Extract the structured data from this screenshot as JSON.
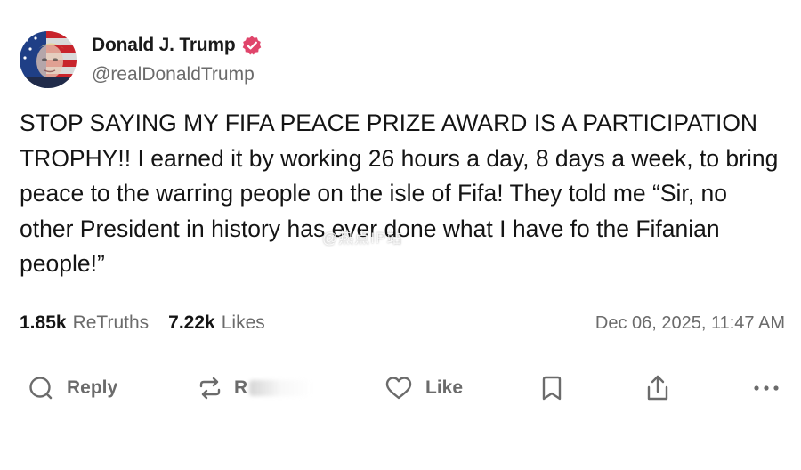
{
  "author": {
    "display_name": "Donald J. Trump",
    "handle": "@realDonaldTrump",
    "verified": true,
    "verified_color": "#e0456b",
    "avatar_icon": "avatar-portrait-flag"
  },
  "post": {
    "text": "STOP SAYING MY FIFA PEACE PRIZE AWARD IS A PARTICIPATION TROPHY!! I earned it by working 26 hours a day, 8 days a week, to bring peace to the warring people on the isle of Fifa! They told me “Sir, no other President in history has ever done what I have fo the Fifanian people!”"
  },
  "stats": {
    "retruths_count": "1.85k",
    "retruths_label": "ReTruths",
    "likes_count": "7.22k",
    "likes_label": "Likes",
    "timestamp": "Dec 06, 2025, 11:47 AM"
  },
  "actions": {
    "reply_label": "Reply",
    "retruth_label": "R",
    "like_label": "Like",
    "icons": [
      "reply-icon",
      "retruth-icon",
      "like-icon",
      "bookmark-icon",
      "share-icon",
      "more-icon"
    ]
  },
  "watermark": {
    "text": "@热点IP站"
  }
}
